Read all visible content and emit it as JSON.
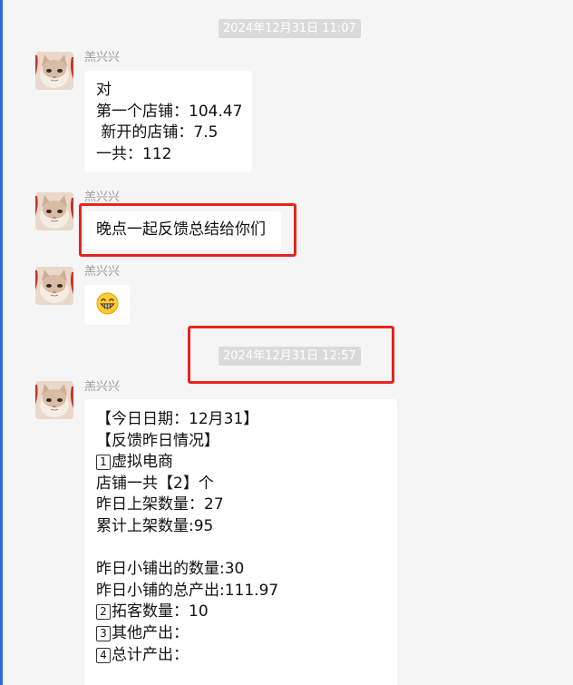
{
  "chat": {
    "timestamps": [
      "2024年12月31日 11:07",
      "2024年12月31日 12:57"
    ],
    "sender_name": "羔兴兴",
    "messages": [
      {
        "lines": [
          "对",
          "第一个店铺：104.47",
          " 新开的店铺：7.5",
          "一共：112"
        ]
      },
      {
        "lines": [
          "晚点一起反馈总结给你们"
        ]
      },
      {
        "emoji": "grinning-face-emoji"
      },
      {
        "lines": [
          "【今日日期：12月31】",
          "【反馈昨日情况】",
          {
            "num": "1",
            "text": "虚拟电商"
          },
          "店铺一共【2】个",
          "昨日上架数量：27",
          "累计上架数量:95",
          "",
          "昨日小铺出的数量:30",
          "昨日小铺的总产出:111.97",
          {
            "num": "2",
            "text": "拓客数量：10"
          },
          {
            "num": "3",
            "text": "其他产出："
          },
          {
            "num": "4",
            "text": "总计产出："
          }
        ]
      }
    ]
  },
  "colors": {
    "background": "#f5f5f5",
    "bubble": "#ffffff",
    "timestamp_bg": "#dadada",
    "highlight_box": "#e8241c",
    "sender_text": "#9a9a9a",
    "left_edge_accent": "#2d6bd9"
  },
  "icons": [
    "cat-avatar-icon",
    "grinning-face-emoji"
  ]
}
